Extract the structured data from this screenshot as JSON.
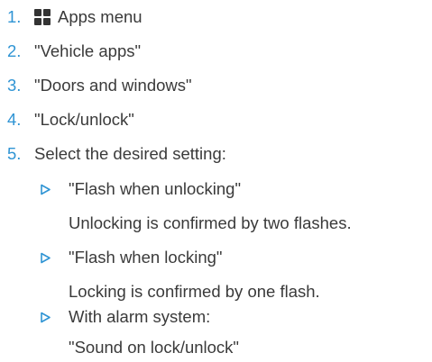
{
  "colors": {
    "accent": "#2f94d4",
    "text": "#3a3a3a",
    "icon": "#333333"
  },
  "steps": [
    {
      "num": "1.",
      "icon": "apps-menu-icon",
      "text": "Apps menu"
    },
    {
      "num": "2.",
      "text": "\"Vehicle apps\""
    },
    {
      "num": "3.",
      "text": "\"Doors and windows\""
    },
    {
      "num": "4.",
      "text": "\"Lock/unlock\""
    },
    {
      "num": "5.",
      "text": "Select the desired setting:"
    }
  ],
  "options": [
    {
      "icon": "triangle-bullet-icon",
      "title": "\"Flash when unlocking\"",
      "detail": "Unlocking is confirmed by two flashes."
    },
    {
      "icon": "triangle-bullet-icon",
      "title": "\"Flash when locking\"",
      "detail": "Locking is confirmed by one flash."
    },
    {
      "icon": "triangle-bullet-icon",
      "title": "With alarm system:",
      "detail": "\"Sound on lock/unlock\""
    }
  ]
}
